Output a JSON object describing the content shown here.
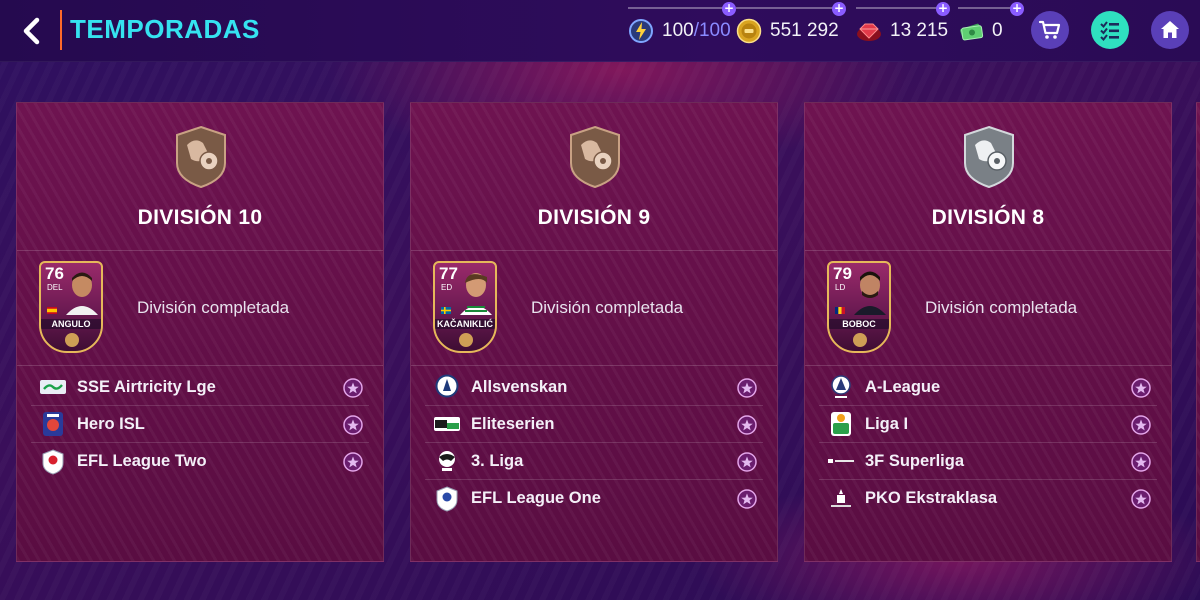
{
  "header": {
    "title": "TEMPORADAS",
    "back_icon": "chevron-left-icon"
  },
  "currencies": [
    {
      "name": "energy",
      "icon": "lightning-icon",
      "value": "100",
      "max": "/100"
    },
    {
      "name": "coins",
      "icon": "fifa-coin-icon",
      "value": "551 292"
    },
    {
      "name": "fifa-points",
      "icon": "gem-icon",
      "value": "13 215"
    },
    {
      "name": "cash",
      "icon": "cash-icon",
      "value": "0"
    }
  ],
  "nav": {
    "shop_icon": "cart-icon",
    "tasks_icon": "checklist-icon",
    "home_icon": "home-icon"
  },
  "colors": {
    "accent": "#35e3f0",
    "divider": "#ff6a2a",
    "card_bg": "#6e1350",
    "bronze_badge": "#8a6a4e",
    "silver_badge": "#9aa0a6"
  },
  "divisions": [
    {
      "title": "DIVISIÓN 10",
      "badge": "bronze-trophy-icon",
      "status": "División completada",
      "player": {
        "rating": "76",
        "position": "DEL",
        "name": "ANGULO"
      },
      "leagues": [
        "SSE Airtricity Lge",
        "Hero ISL",
        "EFL League Two"
      ]
    },
    {
      "title": "DIVISIÓN 9",
      "badge": "bronze-trophy-icon",
      "status": "División completada",
      "player": {
        "rating": "77",
        "position": "ED",
        "name": "KAČANIKLIĆ"
      },
      "leagues": [
        "Allsvenskan",
        "Eliteserien",
        "3. Liga",
        "EFL League One"
      ]
    },
    {
      "title": "DIVISIÓN 8",
      "badge": "silver-trophy-icon",
      "status": "División completada",
      "player": {
        "rating": "79",
        "position": "LD",
        "name": "BOBOC"
      },
      "leagues": [
        "A-League",
        "Liga I",
        "3F Superliga",
        "PKO Ekstraklasa"
      ]
    }
  ]
}
